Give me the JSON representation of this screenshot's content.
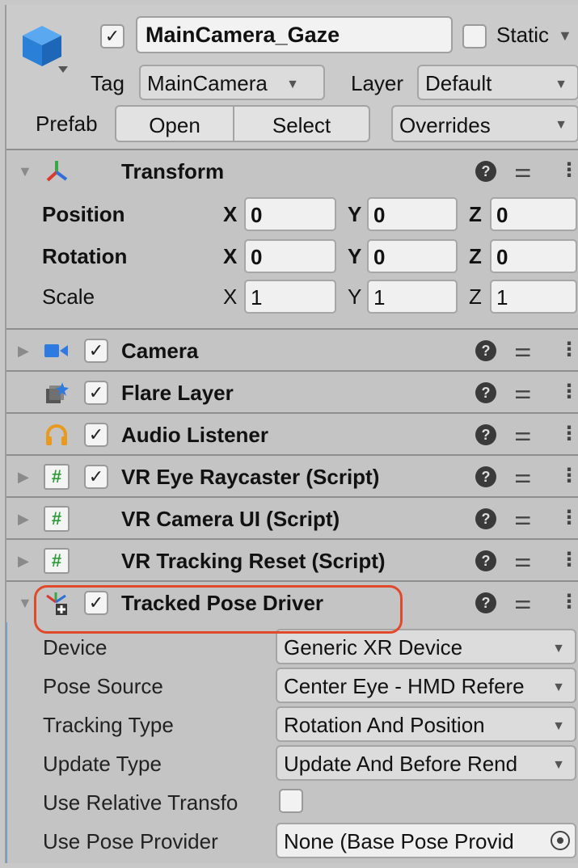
{
  "header": {
    "object_name": "MainCamera_Gaze",
    "active_checked": true,
    "static_label": "Static",
    "tag_label": "Tag",
    "tag_value": "MainCamera",
    "layer_label": "Layer",
    "layer_value": "Default",
    "prefab_label": "Prefab",
    "open_label": "Open",
    "select_label": "Select",
    "overrides_label": "Overrides"
  },
  "transform": {
    "title": "Transform",
    "rows": [
      {
        "label": "Position",
        "x": "0",
        "y": "0",
        "z": "0"
      },
      {
        "label": "Rotation",
        "x": "0",
        "y": "0",
        "z": "0"
      },
      {
        "label": "Scale",
        "x": "1",
        "y": "1",
        "z": "1"
      }
    ],
    "axis_x": "X",
    "axis_y": "Y",
    "axis_z": "Z"
  },
  "components": [
    {
      "title": "Camera",
      "icon": "camera-icon"
    },
    {
      "title": "Flare Layer",
      "icon": "flare-layer-icon"
    },
    {
      "title": "Audio Listener",
      "icon": "headphones-icon"
    },
    {
      "title": "VR Eye Raycaster (Script)",
      "icon": "script-icon"
    },
    {
      "title": "VR Camera UI (Script)",
      "icon": "script-icon"
    },
    {
      "title": "VR Tracking Reset (Script)",
      "icon": "script-icon"
    },
    {
      "title": "Tracked Pose Driver",
      "icon": "tracked-pose-icon"
    }
  ],
  "tracked_pose": {
    "device_label": "Device",
    "device_value": "Generic XR Device",
    "pose_source_label": "Pose Source",
    "pose_source_value": "Center Eye - HMD Refere",
    "tracking_type_label": "Tracking Type",
    "tracking_type_value": "Rotation And Position",
    "update_type_label": "Update Type",
    "update_type_value": "Update And Before Rend",
    "relative_label": "Use Relative Transfo",
    "relative_checked": false,
    "pose_provider_label": "Use Pose Provider",
    "pose_provider_value": "None (Base Pose Provid"
  },
  "help_glyph": "?",
  "checkmark_glyph": "✓",
  "hash_glyph": "#",
  "colors": {
    "highlight": "#e04a2a",
    "selection_bar": "#5aa0e6"
  }
}
